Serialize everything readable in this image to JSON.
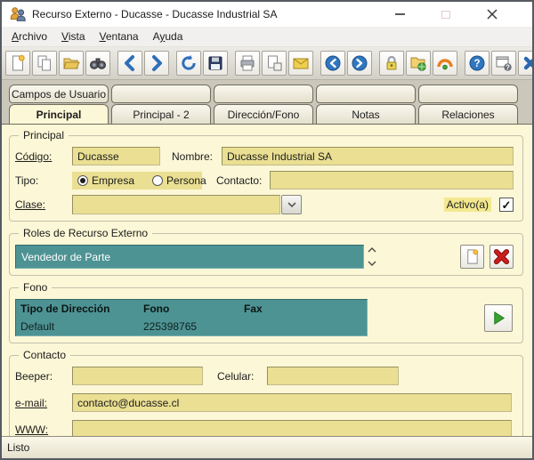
{
  "window": {
    "title": "Recurso Externo - Ducasse - Ducasse Industrial SA",
    "controls": [
      "minimize",
      "maximize",
      "close"
    ]
  },
  "menu": {
    "items": [
      {
        "pre": "",
        "u": "A",
        "post": "rchivo"
      },
      {
        "pre": "",
        "u": "V",
        "post": "ista"
      },
      {
        "pre": "",
        "u": "V",
        "post": "entana"
      },
      {
        "pre": "A",
        "u": "y",
        "post": "uda"
      }
    ]
  },
  "toolbar": {
    "icons": [
      "new-document",
      "copy",
      "open-folder",
      "search-binoculars",
      "chevron-left",
      "chevron-right",
      "refresh",
      "save",
      "print",
      "print-preview",
      "mail",
      "back",
      "forward",
      "lock",
      "folder-permissions",
      "sunrise",
      "help",
      "context-help",
      "exit"
    ]
  },
  "tabs": {
    "top": [
      {
        "label": "Campos de Usuario"
      },
      {
        "label": ""
      },
      {
        "label": ""
      },
      {
        "label": ""
      },
      {
        "label": ""
      }
    ],
    "bottom": [
      {
        "label": "Principal",
        "active": true
      },
      {
        "label": "Principal - 2"
      },
      {
        "label": "Dirección/Fono"
      },
      {
        "label": "Notas"
      },
      {
        "label": "Relaciones"
      }
    ]
  },
  "principal": {
    "legend": "Principal",
    "codigo_label": "Código:",
    "codigo_value": "Ducasse",
    "nombre_label": "Nombre:",
    "nombre_value": "Ducasse Industrial SA",
    "tipo_label": "Tipo:",
    "radio_empresa": "Empresa",
    "radio_persona": "Persona",
    "radio_selected": "Empresa",
    "contacto_label": "Contacto:",
    "contacto_value": "",
    "clase_label": "Clase:",
    "clase_value": "",
    "activo_label": "Activo(a)",
    "activo_checked": true,
    "check_glyph": "✓"
  },
  "roles": {
    "legend": "Roles de Recurso Externo",
    "items": [
      {
        "label": "Vendedor de Parte"
      }
    ]
  },
  "fono": {
    "legend": "Fono",
    "columns": [
      "Tipo de Dirección",
      "Fono",
      "Fax"
    ],
    "rows": [
      {
        "tipo": "Default",
        "fono": "225398765",
        "fax": ""
      }
    ]
  },
  "contacto": {
    "legend": "Contacto",
    "beeper_label": "Beeper:",
    "beeper_value": "",
    "celular_label": "Celular:",
    "celular_value": "",
    "email_label": "e-mail:",
    "email_value": "contacto@ducasse.cl",
    "www_label": "WWW:",
    "www_value": ""
  },
  "statusbar": {
    "text": "Listo"
  },
  "colors": {
    "content_bg": "#fcf7d6",
    "field_yellow": "#eadf92",
    "teal": "#4e9394",
    "tab_cream": "#f2efdf",
    "icon_blue": "#2f6fba",
    "delete_red": "#c41414",
    "play_green": "#3aa12e"
  }
}
